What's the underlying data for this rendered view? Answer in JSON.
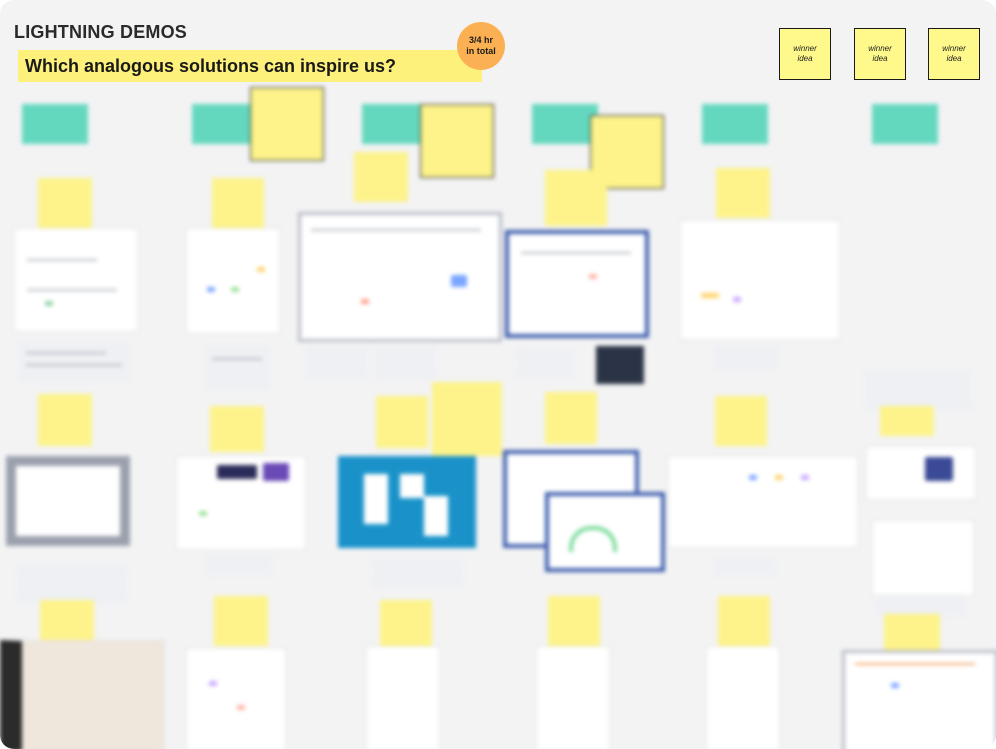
{
  "board": {
    "title": "LIGHTNING DEMOS",
    "question": "Which analogous solutions can inspire us?",
    "time_badge": {
      "line1": "3/4 hr",
      "line2": "in total"
    },
    "winner_ideas": [
      {
        "label": "winner idea"
      },
      {
        "label": "winner idea"
      },
      {
        "label": "winner idea"
      }
    ]
  },
  "colors": {
    "board_background": "#f3f3f4",
    "question_banner": "#fdf07b",
    "time_badge": "#fbb153",
    "sticky_yellow": "#fdf38a",
    "column_tag_teal": "#64d8bf",
    "large_blue_logo": "#1a92c9"
  }
}
